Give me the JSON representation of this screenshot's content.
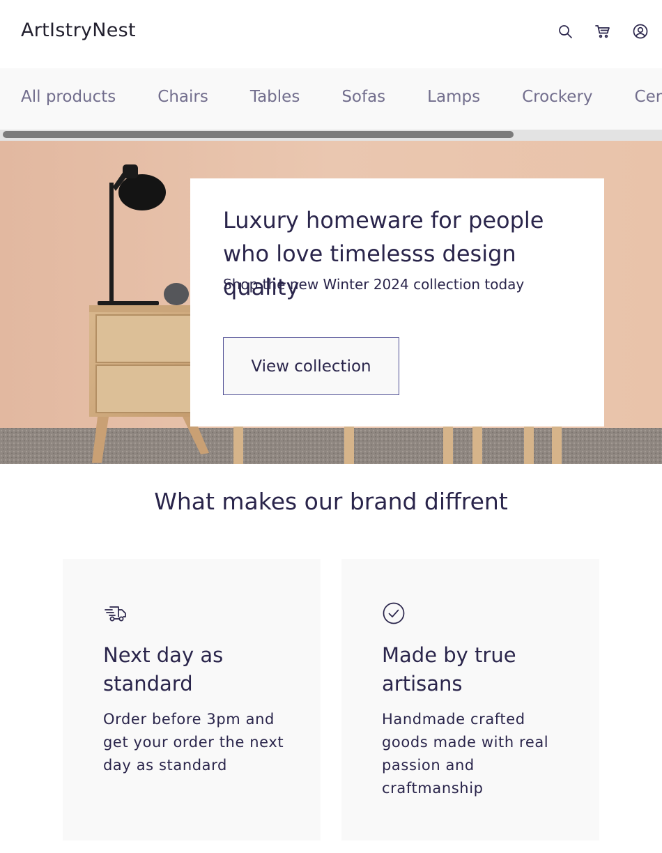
{
  "header": {
    "logo": "ArtIstryNest",
    "icons": [
      "search-icon",
      "cart-icon",
      "user-account-icon"
    ]
  },
  "categories": [
    "All products",
    "Chairs",
    "Tables",
    "Sofas",
    "Lamps",
    "Crockery",
    "Ceramics"
  ],
  "hero": {
    "title": "Luxury homeware for people who love timelesss design quality",
    "subtitle": "Shop the new Winter 2024 collection today",
    "button_label": "View collection"
  },
  "brand": {
    "heading": "What makes our brand diffrent",
    "features": [
      {
        "icon": "delivery-truck-icon",
        "title": "Next day as standard",
        "description": "Order before 3pm and get your order the next day as standard"
      },
      {
        "icon": "checkmark-circle-icon",
        "title": "Made by true artisans",
        "description": "Handmade crafted goods made with real passion and craftmanship"
      }
    ]
  },
  "colors": {
    "primary_text": "#2a254b",
    "nav_text": "#726e8d",
    "light_bg": "#f9f9f9",
    "button_border": "#4e4d93",
    "hero_wall": "#e9c4ab"
  }
}
